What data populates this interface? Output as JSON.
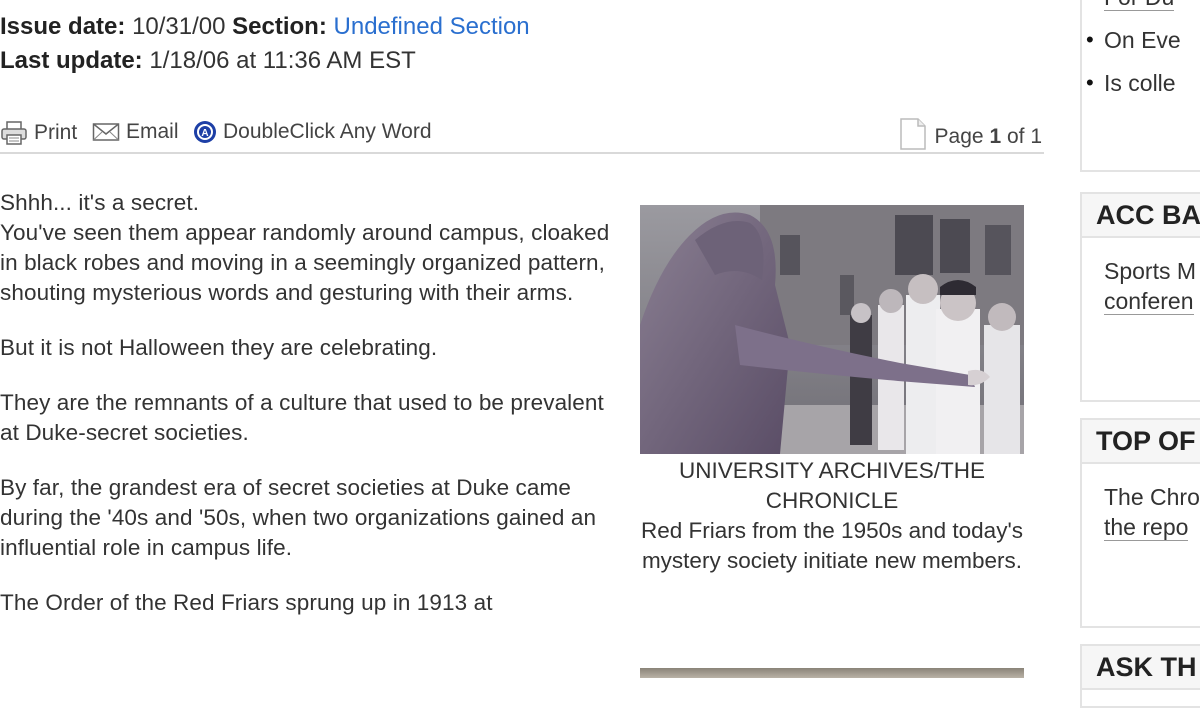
{
  "meta": {
    "issue_label": "Issue date:",
    "issue_date": "10/31/00",
    "section_label": "Section:",
    "section_value": "Undefined Section",
    "update_label": "Last update:",
    "update_value": "1/18/06 at 11:36 AM EST"
  },
  "toolbar": {
    "print": "Print",
    "email": "Email",
    "doubleclick": "DoubleClick Any Word",
    "page_prefix": "Page",
    "page_current": "1",
    "page_of": "of 1"
  },
  "article": {
    "paragraphs": [
      "Shhh... it's a secret.",
      "You've seen them appear randomly around campus, cloaked in black robes and moving in a seemingly organized pattern, shouting mysterious words and gesturing with their arms.",
      "But it is not Halloween they are celebrating.",
      "They are the remnants of a culture that used to be prevalent at Duke-secret societies.",
      "By far, the grandest era of secret societies at Duke came during the '40s and '50s, when two organizations gained an influential role in campus life.",
      "The Order of the Red Friars sprung up in 1913 at"
    ]
  },
  "photo": {
    "credit": "UNIVERSITY ARCHIVES/THE CHRONICLE",
    "caption": "Red Friars from the 1950s and today's mystery society initiate new members."
  },
  "sidebar": {
    "links": [
      "For Du",
      "On Eve",
      "Is colle"
    ],
    "box1": {
      "title": "ACC BA",
      "line1": "Sports M",
      "line2": "conferen"
    },
    "box2": {
      "title": "TOP OF",
      "line1": "The Chro",
      "line2": "the repo"
    },
    "box3": {
      "title": "ASK TH"
    }
  }
}
